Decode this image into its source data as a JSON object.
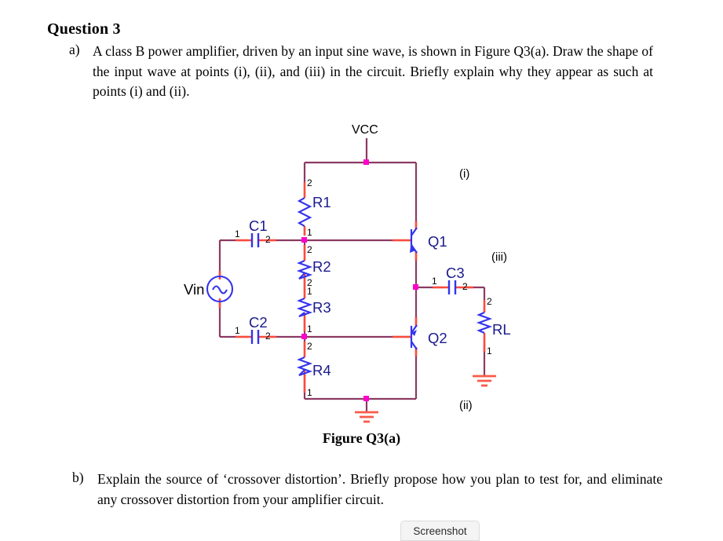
{
  "document": {
    "title": "Question 3",
    "parts": [
      {
        "marker": "a)",
        "text": "A class B power amplifier, driven by an input sine wave, is shown in Figure Q3(a). Draw the shape of the input wave at points (i), (ii), and (iii) in the circuit. Briefly explain why they appear as such at points (i) and (ii)."
      },
      {
        "marker": "b)",
        "text": "Explain the source of ‘crossover distortion’. Briefly propose how you plan to test for, and eliminate any crossover distortion from your amplifier circuit."
      }
    ],
    "figure_caption": "Figure Q3(a)"
  },
  "circuit": {
    "supply_label": "VCC",
    "source_label": "Vin",
    "components": {
      "r1": "R1",
      "r2": "R2",
      "r3": "R3",
      "r4": "R4",
      "rl": "RL",
      "c1": "C1",
      "c2": "C2",
      "c3": "C3",
      "q1": "Q1",
      "q2": "Q2"
    },
    "pin_numbers": {
      "one": "1",
      "two": "2"
    },
    "test_points": {
      "i": "(i)",
      "ii": "(ii)",
      "iii": "(iii)"
    },
    "colors": {
      "wire": "#8b3a62",
      "pin": "#fa4b3c",
      "node": "#ff00cc",
      "symbol": "#3333ee",
      "ground": "#fb5a4a",
      "text_dark": "#1a1a8c"
    }
  },
  "toolbar": {
    "screenshot_label": "Screenshot"
  }
}
